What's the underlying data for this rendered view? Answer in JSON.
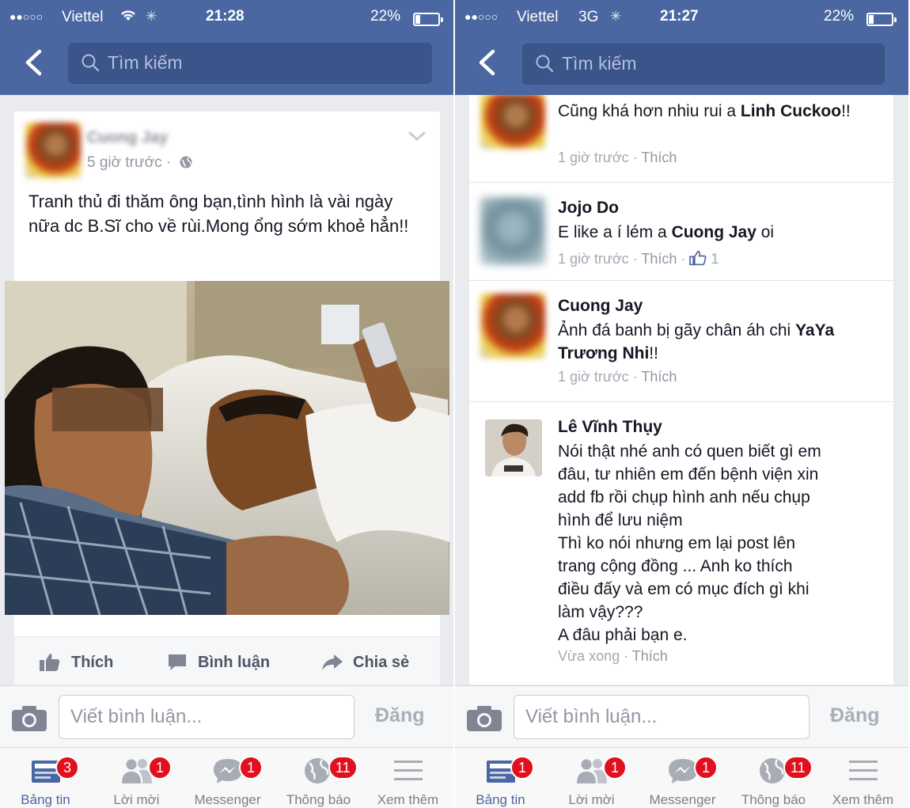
{
  "left": {
    "status": {
      "dots": "●●○○○",
      "carrier": "Viettel",
      "time": "21:28",
      "battery": "22%"
    },
    "search": {
      "placeholder": "Tìm kiếm"
    },
    "post": {
      "author": "Cuong Jay",
      "meta": "5 giờ trước ·",
      "text": "Tranh thủ đi thăm ông bạn,tình hình là vài ngày nữa dc B.Sĩ cho về rùi.Mong ổng sớm khoẻ hẳn!!",
      "like_label": "Thích",
      "comment_label": "Bình luận",
      "share_label": "Chia sẻ"
    },
    "composer": {
      "placeholder": "Viết bình luận...",
      "post_label": "Đăng"
    },
    "tabs": [
      {
        "label": "Bảng tin",
        "badge": "3",
        "icon": "news-feed-icon"
      },
      {
        "label": "Lời mời",
        "badge": "1",
        "icon": "friend-requests-icon"
      },
      {
        "label": "Messenger",
        "badge": "1",
        "icon": "messenger-icon"
      },
      {
        "label": "Thông báo",
        "badge": "11",
        "icon": "globe-icon"
      },
      {
        "label": "Xem thêm",
        "badge": "",
        "icon": "menu-icon"
      }
    ]
  },
  "right": {
    "status": {
      "dots": "●●○○○",
      "carrier": "Viettel",
      "network": "3G",
      "time": "21:27",
      "battery": "22%"
    },
    "search": {
      "placeholder": "Tìm kiếm"
    },
    "comments": [
      {
        "name": "",
        "text_pre": "Cũng khá hơn nhiu rui a ",
        "mention": "Linh Cuckoo",
        "text_post": "!!",
        "time": "1 giờ trước",
        "like": "Thích"
      },
      {
        "name": "Jojo Do",
        "text_pre": "E like a í lém a ",
        "mention": "Cuong Jay",
        "text_post": " oi",
        "time": "1 giờ trước",
        "like": "Thích",
        "likes": "1"
      },
      {
        "name": "Cuong Jay",
        "text_pre": "Ảnh đá banh bị gãy chân áh chi ",
        "mention": "YaYa Trương Nhi",
        "text_post": "!!",
        "time": "1 giờ trước",
        "like": "Thích"
      },
      {
        "name": "Lê Vĩnh Thụy",
        "lines": [
          "Nói thật nhé anh có quen biết gì em",
          "đâu, tư nhiên em đến bệnh viện xin",
          "add fb rồi chụp hình anh nếu chụp",
          "hình để lưu niệm",
          "Thì ko nói nhưng em lại post lên",
          "trang cộng đồng ... Anh ko thích",
          "điều đấy và em có mục đích gì khi",
          "làm vậy???",
          "A đâu phải bạn e."
        ],
        "time": "Vừa xong",
        "like": "Thích"
      }
    ],
    "composer": {
      "placeholder": "Viết bình luận...",
      "post_label": "Đăng"
    },
    "tabs": [
      {
        "label": "Bảng tin",
        "badge": "1",
        "icon": "news-feed-icon"
      },
      {
        "label": "Lời mời",
        "badge": "1",
        "icon": "friend-requests-icon"
      },
      {
        "label": "Messenger",
        "badge": "1",
        "icon": "messenger-icon"
      },
      {
        "label": "Thông báo",
        "badge": "11",
        "icon": "globe-icon"
      },
      {
        "label": "Xem thêm",
        "badge": "",
        "icon": "menu-icon"
      }
    ]
  },
  "colors": {
    "header": "#4b67a1",
    "search_bg": "#3b5489",
    "badge": "#e0101f",
    "active_tab": "#4b67a1"
  }
}
